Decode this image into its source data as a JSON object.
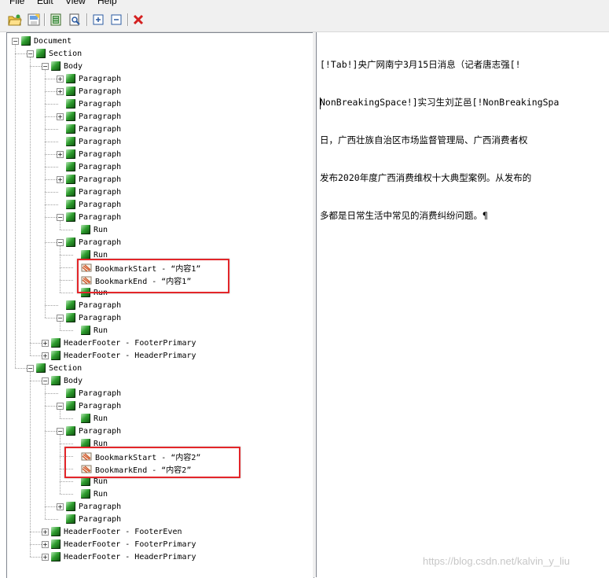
{
  "menu": {
    "items": [
      "File",
      "Edit",
      "View",
      "Help"
    ]
  },
  "toolbar": {
    "buttons": [
      "open-icon",
      "save-icon",
      "document-view-icon",
      "preview-icon",
      "expand-all-icon",
      "collapse-all-icon",
      "delete-icon"
    ]
  },
  "tree": {
    "nodes": [
      {
        "label": "Document",
        "icon": "cube"
      },
      {
        "label": "Section",
        "icon": "cube"
      },
      {
        "label": "Body",
        "icon": "cube"
      },
      {
        "label": "Paragraph",
        "icon": "cube"
      },
      {
        "label": "Paragraph",
        "icon": "cube"
      },
      {
        "label": "Paragraph",
        "icon": "cube"
      },
      {
        "label": "Paragraph",
        "icon": "cube"
      },
      {
        "label": "Paragraph",
        "icon": "cube"
      },
      {
        "label": "Paragraph",
        "icon": "cube"
      },
      {
        "label": "Paragraph",
        "icon": "cube"
      },
      {
        "label": "Paragraph",
        "icon": "cube"
      },
      {
        "label": "Paragraph",
        "icon": "cube"
      },
      {
        "label": "Paragraph",
        "icon": "cube"
      },
      {
        "label": "Paragraph",
        "icon": "cube"
      },
      {
        "label": "Paragraph",
        "icon": "cube"
      },
      {
        "label": "Run",
        "icon": "cube"
      },
      {
        "label": "Paragraph",
        "icon": "cube"
      },
      {
        "label": "Run",
        "icon": "cube"
      },
      {
        "label": "BookmarkStart - “内容1”",
        "icon": "bookmark"
      },
      {
        "label": "BookmarkEnd - “内容1”",
        "icon": "bookmark"
      },
      {
        "label": "Run",
        "icon": "cube"
      },
      {
        "label": "Paragraph",
        "icon": "cube"
      },
      {
        "label": "Paragraph",
        "icon": "cube"
      },
      {
        "label": "Run",
        "icon": "cube"
      },
      {
        "label": "HeaderFooter - FooterPrimary",
        "icon": "cube"
      },
      {
        "label": "HeaderFooter - HeaderPrimary",
        "icon": "cube"
      },
      {
        "label": "Section",
        "icon": "cube"
      },
      {
        "label": "Body",
        "icon": "cube"
      },
      {
        "label": "Paragraph",
        "icon": "cube"
      },
      {
        "label": "Paragraph",
        "icon": "cube"
      },
      {
        "label": "Run",
        "icon": "cube"
      },
      {
        "label": "Paragraph",
        "icon": "cube"
      },
      {
        "label": "Run",
        "icon": "cube"
      },
      {
        "label": "BookmarkStart - “内容2”",
        "icon": "bookmark"
      },
      {
        "label": "BookmarkEnd - “内容2”",
        "icon": "bookmark"
      },
      {
        "label": "Run",
        "icon": "cube"
      },
      {
        "label": "Run",
        "icon": "cube"
      },
      {
        "label": "Paragraph",
        "icon": "cube"
      },
      {
        "label": "Paragraph",
        "icon": "cube"
      },
      {
        "label": "HeaderFooter - FooterEven",
        "icon": "cube"
      },
      {
        "label": "HeaderFooter - FooterPrimary",
        "icon": "cube"
      },
      {
        "label": "HeaderFooter - HeaderPrimary",
        "icon": "cube"
      }
    ]
  },
  "document": {
    "lines": [
      "[!Tab!]央广网南宁3月15日消息（记者唐志强[!",
      "NonBreakingSpace!]实习生刘芷邑[!NonBreakingSpa",
      "日，广西壮族自治区市场监督管理局、广西消费者权",
      "发布2020年度广西消费维权十大典型案例。从发布的",
      "多都是日常生活中常见的消费纠纷问题。¶"
    ]
  },
  "watermark": "https://blog.csdn.net/kalvin_y_liu",
  "highlight_color": "#e3262a"
}
